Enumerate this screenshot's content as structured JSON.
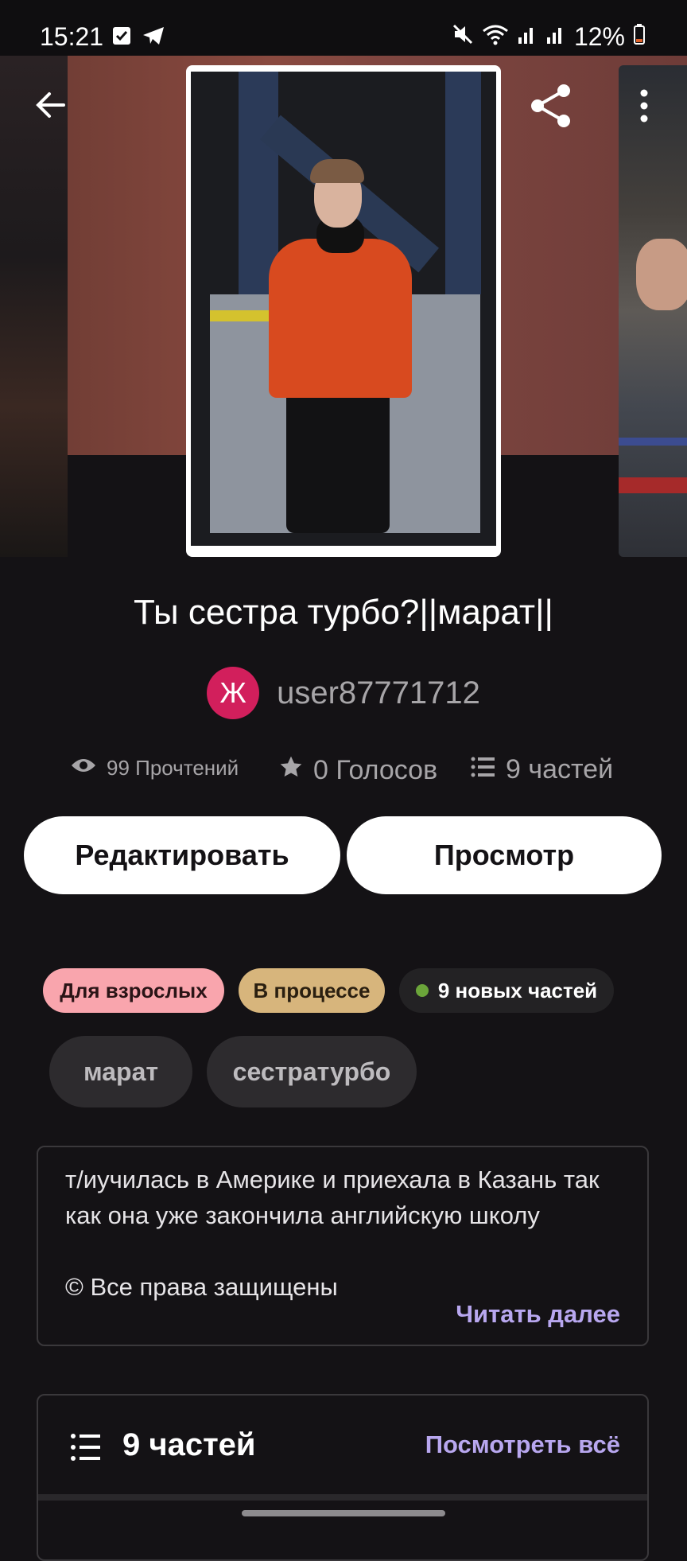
{
  "status_bar": {
    "time": "15:21",
    "battery": "12%",
    "icons": [
      "check-box-icon",
      "telegram-icon",
      "mute-icon",
      "wifi-icon",
      "signal-icon",
      "signal-icon",
      "battery-icon"
    ]
  },
  "header": {
    "back_icon": "arrow-left-icon",
    "share_icon": "share-icon",
    "more_icon": "more-vertical-icon"
  },
  "story": {
    "title": "Ты сестра турбо?||марат||",
    "author": {
      "avatar_letter": "Ж",
      "name": "user87771712",
      "avatar_color": "#d21f5c"
    },
    "stats": {
      "reads": "99 Прочтений",
      "votes": "0 Голосов",
      "parts": "9 частей"
    },
    "buttons": {
      "edit": "Редактировать",
      "preview": "Просмотр"
    },
    "tags": {
      "mature": "Для взрослых",
      "status": "В процессе",
      "new_parts": "9 новых частей"
    },
    "chips": [
      "марат",
      "сестратурбо"
    ],
    "description": {
      "text": "т/иучилась в Америке и приехала в Казань так как она уже закончила английскую школу\n\n© Все права защищены",
      "read_more": "Читать далее"
    },
    "parts_section": {
      "title": "9 частей",
      "view_all": "Посмотреть всё"
    }
  },
  "colors": {
    "background": "#141215",
    "accent_link": "#b8a7ef",
    "mature_tag": "#f9a5ad",
    "status_tag": "#d7b57c",
    "new_dot": "#6ba53a"
  }
}
